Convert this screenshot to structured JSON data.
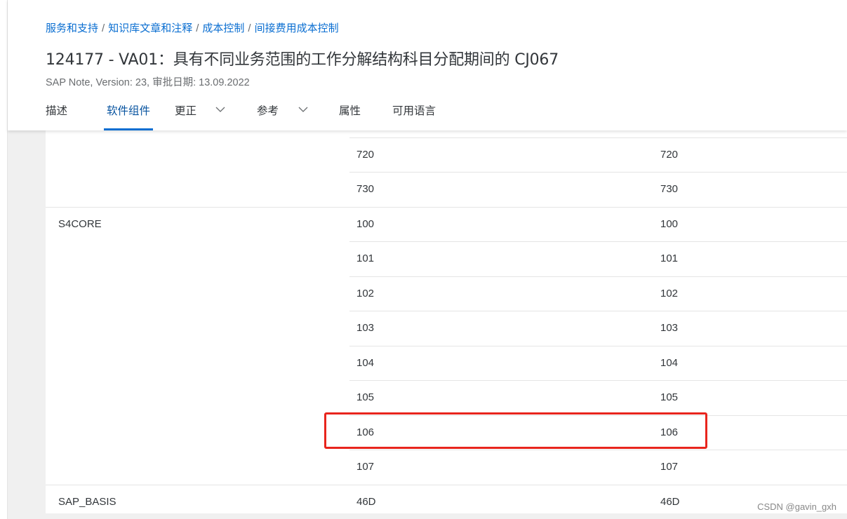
{
  "breadcrumb": {
    "items": [
      "服务和支持",
      "知识库文章和注释",
      "成本控制",
      "间接费用成本控制"
    ],
    "separator": "/"
  },
  "title": "124177 - VA01：具有不同业务范围的工作分解结构科目分配期间的 CJ067",
  "subtitle": "SAP Note, Version: 23, 审批日期: 13.09.2022",
  "tabs": [
    {
      "label": "描述",
      "active": false,
      "dropdown": false
    },
    {
      "label": "软件组件",
      "active": true,
      "dropdown": false
    },
    {
      "label": "更正",
      "active": false,
      "dropdown": true
    },
    {
      "label": "参考",
      "active": false,
      "dropdown": true
    },
    {
      "label": "属性",
      "active": false,
      "dropdown": false
    },
    {
      "label": "可用语言",
      "active": false,
      "dropdown": false
    }
  ],
  "table": {
    "rows": [
      {
        "component": "",
        "from": "720",
        "to": "720"
      },
      {
        "component": "",
        "from": "730",
        "to": "730"
      },
      {
        "component": "S4CORE",
        "from": "100",
        "to": "100"
      },
      {
        "component": "",
        "from": "101",
        "to": "101"
      },
      {
        "component": "",
        "from": "102",
        "to": "102"
      },
      {
        "component": "",
        "from": "103",
        "to": "103"
      },
      {
        "component": "",
        "from": "104",
        "to": "104"
      },
      {
        "component": "",
        "from": "105",
        "to": "105"
      },
      {
        "component": "",
        "from": "106",
        "to": "106",
        "highlighted": true
      },
      {
        "component": "",
        "from": "107",
        "to": "107"
      },
      {
        "component": "SAP_BASIS",
        "from": "46D",
        "to": "46D"
      }
    ]
  },
  "highlight_color": "#e8251d",
  "accent_color": "#0a6ed1",
  "watermark": "CSDN @gavin_gxh"
}
